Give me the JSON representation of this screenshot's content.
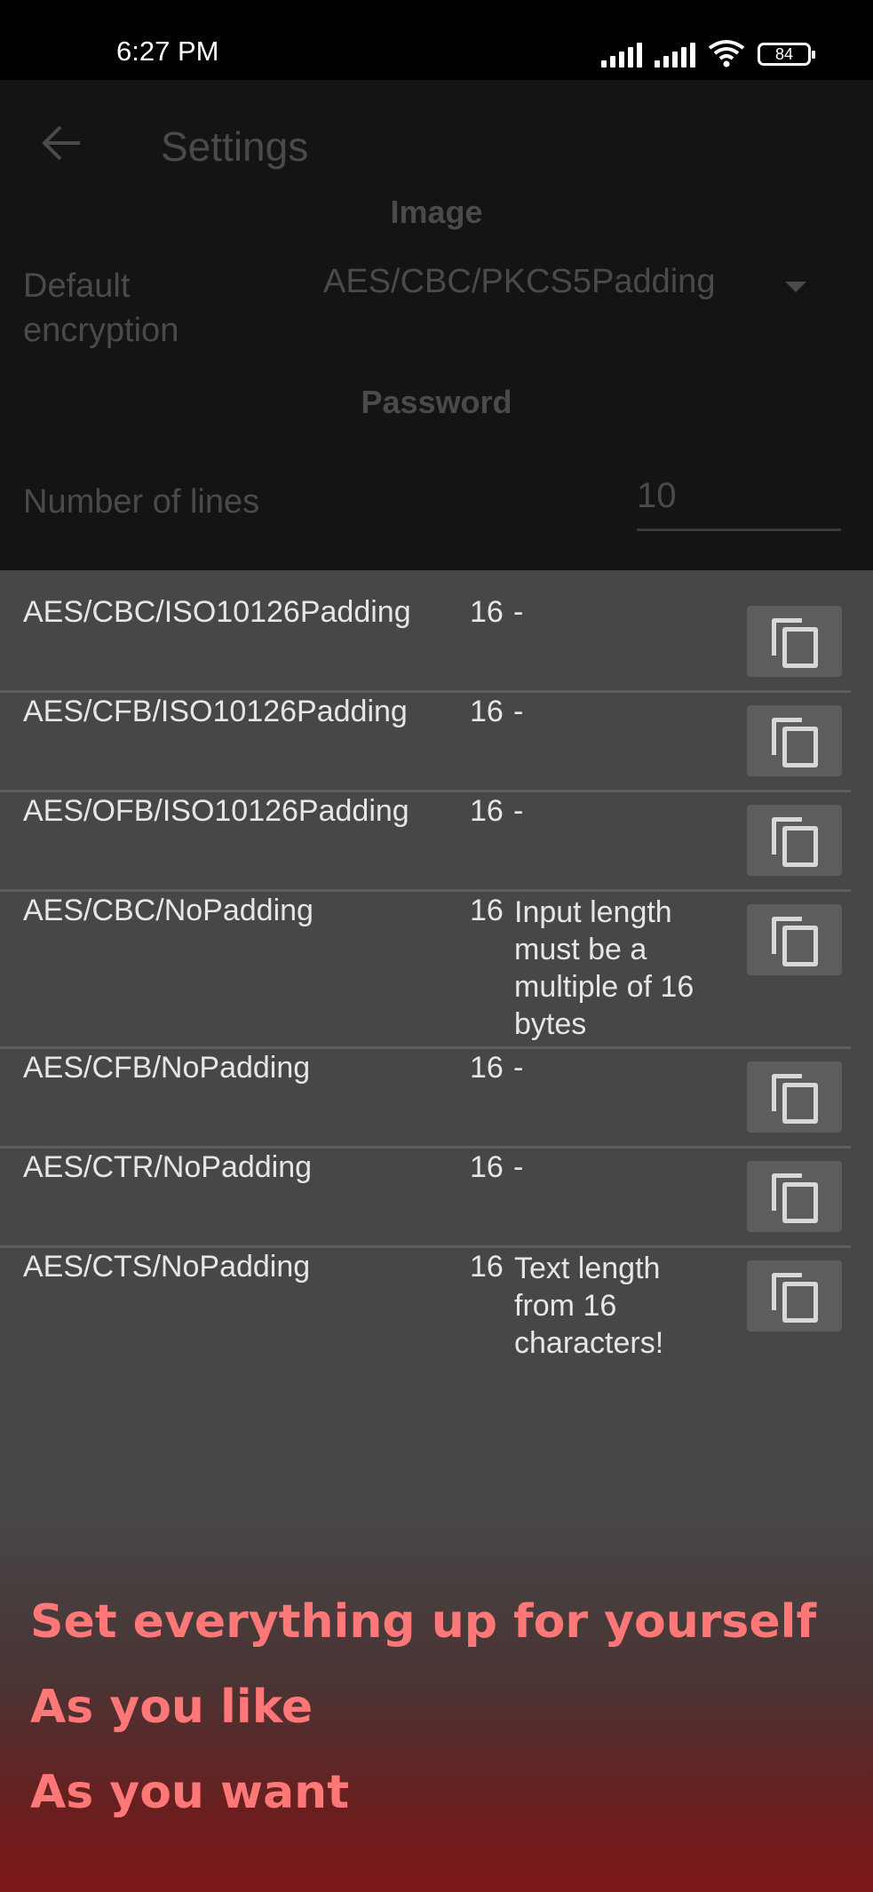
{
  "status_bar": {
    "time": "6:27 PM",
    "battery": "84"
  },
  "header": {
    "title": "Settings"
  },
  "image_section": {
    "title": "Image",
    "default_encryption_label": "Default encryption",
    "default_encryption_value": "AES/CBC/PKCS5Padding"
  },
  "password_section": {
    "title": "Password",
    "number_of_lines_label": "Number of lines",
    "number_of_lines_value": "10"
  },
  "rows": [
    {
      "name": "AES/CBC/ISO10126Padding",
      "size": "16",
      "note": "-"
    },
    {
      "name": "AES/CFB/ISO10126Padding",
      "size": "16",
      "note": "-"
    },
    {
      "name": "AES/OFB/ISO10126Padding",
      "size": "16",
      "note": "-"
    },
    {
      "name": "AES/CBC/NoPadding",
      "size": "16",
      "note": "Input length must be a multiple of 16 bytes"
    },
    {
      "name": "AES/CFB/NoPadding",
      "size": "16",
      "note": "-"
    },
    {
      "name": "AES/CTR/NoPadding",
      "size": "16",
      "note": "-"
    },
    {
      "name": "AES/CTS/NoPadding",
      "size": "16",
      "note": "Text length from 16 characters!"
    }
  ],
  "promo": {
    "line1": "Set everything up for yourself",
    "line2": "As you like",
    "line3": "As you want"
  },
  "colors": {
    "promo_text": "#ff7777",
    "panel": "#474747",
    "gradient_end": "#7d1818"
  }
}
